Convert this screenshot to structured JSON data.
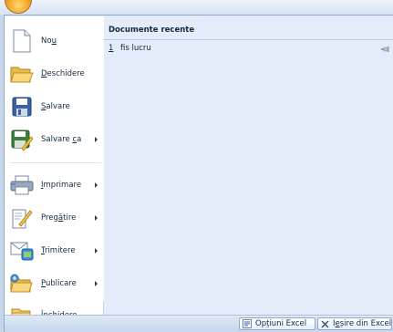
{
  "menu": {
    "items": [
      {
        "id": "nou",
        "pre": "No",
        "u": "u",
        "post": "",
        "has_submenu": false
      },
      {
        "id": "deschidere",
        "pre": "",
        "u": "D",
        "post": "eschidere",
        "has_submenu": false
      },
      {
        "id": "salvare",
        "pre": "",
        "u": "S",
        "post": "alvare",
        "has_submenu": false
      },
      {
        "id": "salvare-ca",
        "pre": "Salvare ",
        "u": "c",
        "post": "a",
        "has_submenu": true
      },
      {
        "id": "imprimare",
        "pre": "",
        "u": "I",
        "post": "mprimare",
        "has_submenu": true
      },
      {
        "id": "pregatire",
        "pre": "Preg",
        "u": "ă",
        "post": "tire",
        "has_submenu": true
      },
      {
        "id": "trimitere",
        "pre": "",
        "u": "T",
        "post": "rimitere",
        "has_submenu": true
      },
      {
        "id": "publicare",
        "pre": "",
        "u": "P",
        "post": "ublicare",
        "has_submenu": true
      },
      {
        "id": "inchidere",
        "pre": "Înc",
        "u": "h",
        "post": "idere",
        "has_submenu": false
      }
    ]
  },
  "recent": {
    "header": "Documente recente",
    "items": [
      {
        "num": "1",
        "name": "fis lucru"
      }
    ]
  },
  "bottom": {
    "options_pre": "Op",
    "options_u": "ț",
    "options_post": "iuni Excel",
    "exit_pre": "I",
    "exit_u": "e",
    "exit_post": "șire din Excel"
  }
}
